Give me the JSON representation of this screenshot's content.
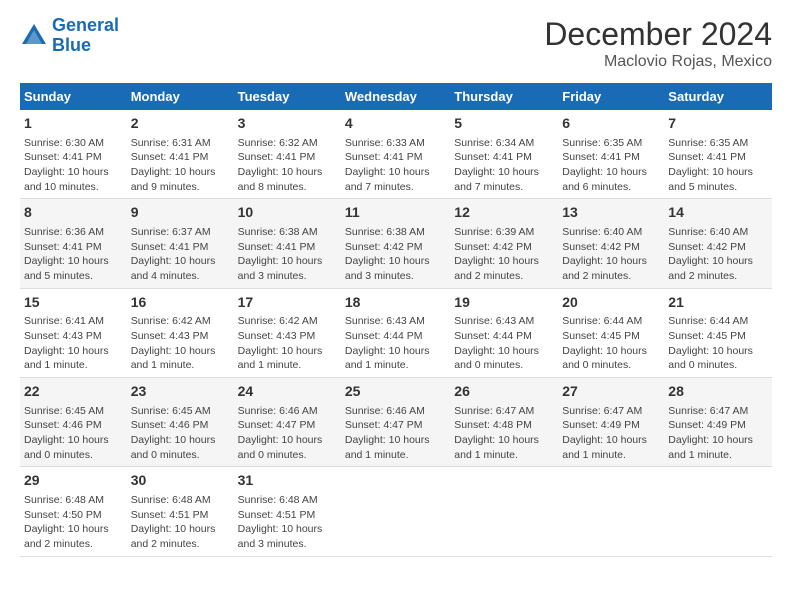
{
  "logo": {
    "line1": "General",
    "line2": "Blue"
  },
  "title": "December 2024",
  "location": "Maclovio Rojas, Mexico",
  "headers": [
    "Sunday",
    "Monday",
    "Tuesday",
    "Wednesday",
    "Thursday",
    "Friday",
    "Saturday"
  ],
  "weeks": [
    [
      {
        "day": "1",
        "info": "Sunrise: 6:30 AM\nSunset: 4:41 PM\nDaylight: 10 hours\nand 10 minutes."
      },
      {
        "day": "2",
        "info": "Sunrise: 6:31 AM\nSunset: 4:41 PM\nDaylight: 10 hours\nand 9 minutes."
      },
      {
        "day": "3",
        "info": "Sunrise: 6:32 AM\nSunset: 4:41 PM\nDaylight: 10 hours\nand 8 minutes."
      },
      {
        "day": "4",
        "info": "Sunrise: 6:33 AM\nSunset: 4:41 PM\nDaylight: 10 hours\nand 7 minutes."
      },
      {
        "day": "5",
        "info": "Sunrise: 6:34 AM\nSunset: 4:41 PM\nDaylight: 10 hours\nand 7 minutes."
      },
      {
        "day": "6",
        "info": "Sunrise: 6:35 AM\nSunset: 4:41 PM\nDaylight: 10 hours\nand 6 minutes."
      },
      {
        "day": "7",
        "info": "Sunrise: 6:35 AM\nSunset: 4:41 PM\nDaylight: 10 hours\nand 5 minutes."
      }
    ],
    [
      {
        "day": "8",
        "info": "Sunrise: 6:36 AM\nSunset: 4:41 PM\nDaylight: 10 hours\nand 5 minutes."
      },
      {
        "day": "9",
        "info": "Sunrise: 6:37 AM\nSunset: 4:41 PM\nDaylight: 10 hours\nand 4 minutes."
      },
      {
        "day": "10",
        "info": "Sunrise: 6:38 AM\nSunset: 4:41 PM\nDaylight: 10 hours\nand 3 minutes."
      },
      {
        "day": "11",
        "info": "Sunrise: 6:38 AM\nSunset: 4:42 PM\nDaylight: 10 hours\nand 3 minutes."
      },
      {
        "day": "12",
        "info": "Sunrise: 6:39 AM\nSunset: 4:42 PM\nDaylight: 10 hours\nand 2 minutes."
      },
      {
        "day": "13",
        "info": "Sunrise: 6:40 AM\nSunset: 4:42 PM\nDaylight: 10 hours\nand 2 minutes."
      },
      {
        "day": "14",
        "info": "Sunrise: 6:40 AM\nSunset: 4:42 PM\nDaylight: 10 hours\nand 2 minutes."
      }
    ],
    [
      {
        "day": "15",
        "info": "Sunrise: 6:41 AM\nSunset: 4:43 PM\nDaylight: 10 hours\nand 1 minute."
      },
      {
        "day": "16",
        "info": "Sunrise: 6:42 AM\nSunset: 4:43 PM\nDaylight: 10 hours\nand 1 minute."
      },
      {
        "day": "17",
        "info": "Sunrise: 6:42 AM\nSunset: 4:43 PM\nDaylight: 10 hours\nand 1 minute."
      },
      {
        "day": "18",
        "info": "Sunrise: 6:43 AM\nSunset: 4:44 PM\nDaylight: 10 hours\nand 1 minute."
      },
      {
        "day": "19",
        "info": "Sunrise: 6:43 AM\nSunset: 4:44 PM\nDaylight: 10 hours\nand 0 minutes."
      },
      {
        "day": "20",
        "info": "Sunrise: 6:44 AM\nSunset: 4:45 PM\nDaylight: 10 hours\nand 0 minutes."
      },
      {
        "day": "21",
        "info": "Sunrise: 6:44 AM\nSunset: 4:45 PM\nDaylight: 10 hours\nand 0 minutes."
      }
    ],
    [
      {
        "day": "22",
        "info": "Sunrise: 6:45 AM\nSunset: 4:46 PM\nDaylight: 10 hours\nand 0 minutes."
      },
      {
        "day": "23",
        "info": "Sunrise: 6:45 AM\nSunset: 4:46 PM\nDaylight: 10 hours\nand 0 minutes."
      },
      {
        "day": "24",
        "info": "Sunrise: 6:46 AM\nSunset: 4:47 PM\nDaylight: 10 hours\nand 0 minutes."
      },
      {
        "day": "25",
        "info": "Sunrise: 6:46 AM\nSunset: 4:47 PM\nDaylight: 10 hours\nand 1 minute."
      },
      {
        "day": "26",
        "info": "Sunrise: 6:47 AM\nSunset: 4:48 PM\nDaylight: 10 hours\nand 1 minute."
      },
      {
        "day": "27",
        "info": "Sunrise: 6:47 AM\nSunset: 4:49 PM\nDaylight: 10 hours\nand 1 minute."
      },
      {
        "day": "28",
        "info": "Sunrise: 6:47 AM\nSunset: 4:49 PM\nDaylight: 10 hours\nand 1 minute."
      }
    ],
    [
      {
        "day": "29",
        "info": "Sunrise: 6:48 AM\nSunset: 4:50 PM\nDaylight: 10 hours\nand 2 minutes."
      },
      {
        "day": "30",
        "info": "Sunrise: 6:48 AM\nSunset: 4:51 PM\nDaylight: 10 hours\nand 2 minutes."
      },
      {
        "day": "31",
        "info": "Sunrise: 6:48 AM\nSunset: 4:51 PM\nDaylight: 10 hours\nand 3 minutes."
      },
      {
        "day": "",
        "info": ""
      },
      {
        "day": "",
        "info": ""
      },
      {
        "day": "",
        "info": ""
      },
      {
        "day": "",
        "info": ""
      }
    ]
  ]
}
